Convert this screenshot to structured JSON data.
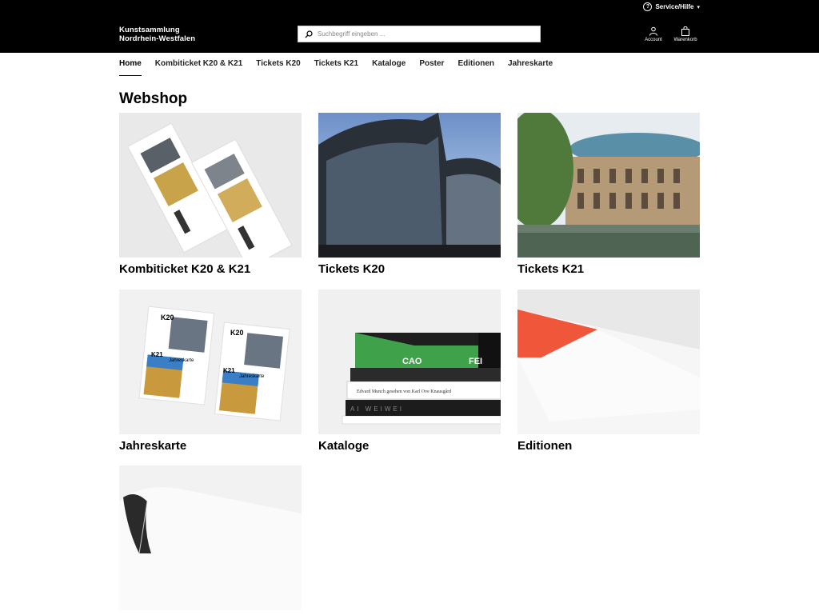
{
  "header": {
    "service_label": "Service/Hilfe",
    "brand_line1": "Kunstsammlung",
    "brand_line2": "Nordrhein-Westfalen",
    "search_placeholder": "Suchbegriff eingeben ...",
    "account_label": "Account",
    "cart_label": "Warenkorb"
  },
  "nav": {
    "items": [
      {
        "label": "Home",
        "active": true
      },
      {
        "label": "Kombiticket K20 & K21"
      },
      {
        "label": "Tickets K20"
      },
      {
        "label": "Tickets K21"
      },
      {
        "label": "Kataloge"
      },
      {
        "label": "Poster"
      },
      {
        "label": "Editionen"
      },
      {
        "label": "Jahreskarte"
      }
    ]
  },
  "page": {
    "title": "Webshop",
    "tiles": [
      {
        "label": "Kombiticket K20 & K21"
      },
      {
        "label": "Tickets K20"
      },
      {
        "label": "Tickets K21"
      },
      {
        "label": "Jahreskarte"
      },
      {
        "label": "Kataloge"
      },
      {
        "label": "Editionen"
      },
      {
        "label": ""
      }
    ],
    "art": {
      "k20": "K20",
      "k21": "K21",
      "jahreskarte": "Jahreskarte",
      "book_cao": "CAO",
      "book_fei": "FEI",
      "book_munch": "Edvard Munch   gesehen von   Karl Ove Knausgård",
      "book_aiweiwei": "AI WEIWEI"
    }
  },
  "colors": {
    "header_bg": "#000000",
    "accent_orange": "#f0563a"
  }
}
